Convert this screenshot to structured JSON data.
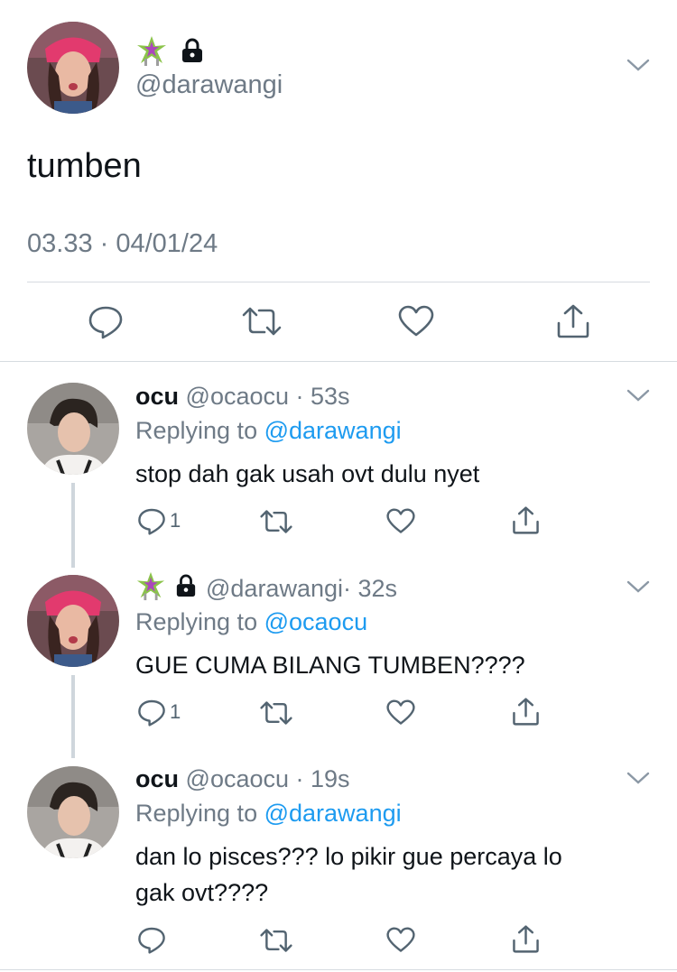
{
  "main_tweet": {
    "handle": "@darawangi",
    "text": "tumben",
    "timestamp": "03.33 · 04/01/24",
    "icons": [
      "reply-icon",
      "retweet-icon",
      "like-icon",
      "share-icon"
    ]
  },
  "replies": [
    {
      "name": "ocu",
      "handle": "@ocaocu",
      "time": "· 53s",
      "replying_prefix": "Replying to",
      "replying_to": "@darawangi",
      "text_lines": [
        "stop dah gak usah ovt dulu nyet"
      ],
      "reply_count": "1"
    },
    {
      "name": "",
      "handle": "@darawangi",
      "time": "· 32s",
      "replying_prefix": "Replying to",
      "replying_to": "@ocaocu",
      "text_lines": [
        "GUE CUMA BILANG TUMBEN????"
      ],
      "reply_count": "1"
    },
    {
      "name": "ocu",
      "handle": "@ocaocu",
      "time": "· 19s",
      "replying_prefix": "Replying to",
      "replying_to": "@darawangi",
      "text_lines": [
        "dan lo pisces??? lo pikir gue percaya lo",
        "gak ovt????"
      ],
      "reply_count": ""
    }
  ],
  "colors": {
    "link": "#1d9bf0",
    "secondary_text": "#6e7a86",
    "icon": "#536471",
    "separator": "#d6dbe0"
  }
}
